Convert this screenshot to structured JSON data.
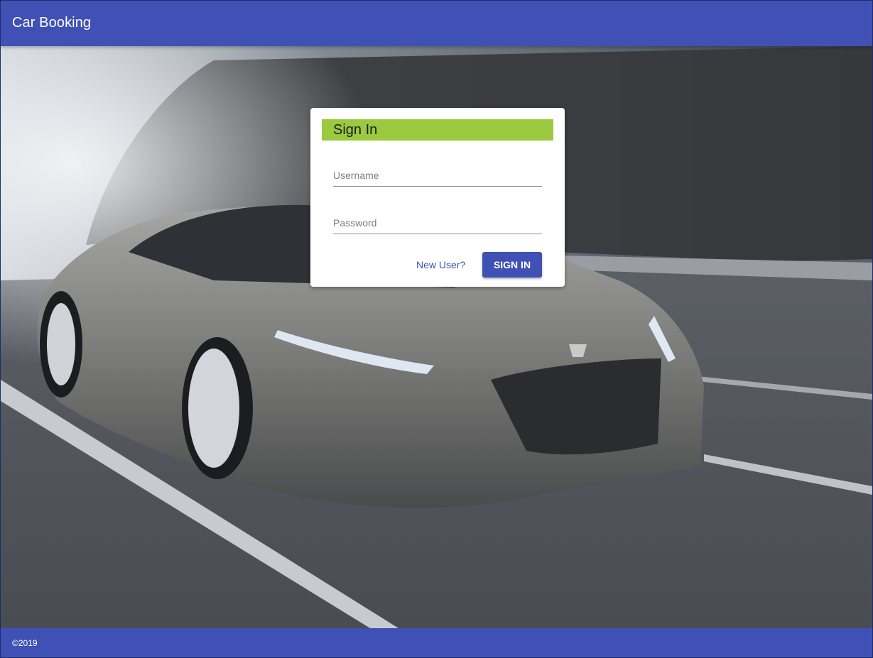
{
  "header": {
    "title": "Car Booking"
  },
  "background": {
    "image": "sports car on road",
    "accent": "#3f51b5"
  },
  "signin_card": {
    "title": "Sign In",
    "header_color": "#9bc93f",
    "username": {
      "placeholder": "Username",
      "value": ""
    },
    "password": {
      "placeholder": "Password",
      "value": ""
    },
    "new_user_link": "New User?",
    "submit_label": "SIGN IN"
  },
  "footer": {
    "copyright": "©2019"
  }
}
